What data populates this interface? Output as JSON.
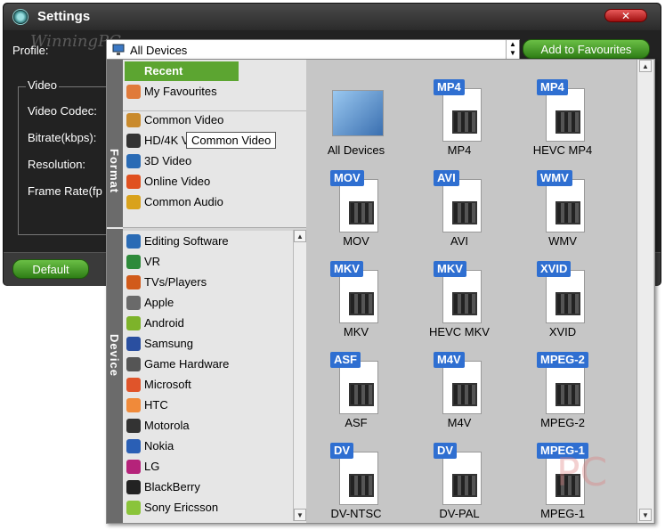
{
  "window": {
    "title": "Settings",
    "close_label": "✕",
    "watermark": "WinningPC"
  },
  "profile": {
    "label": "Profile:",
    "value": "All Devices",
    "add_favourites_label": "Add to Favourites"
  },
  "video_settings": {
    "group_label": "Video",
    "labels": [
      "Video Codec:",
      "Bitrate(kbps):",
      "Resolution:",
      "Frame Rate(fp"
    ]
  },
  "default_button_label": "Default",
  "left_panel": {
    "format_tab_label": "Format",
    "device_tab_label": "Device",
    "format_items": [
      {
        "label": "Recent",
        "icon": "grid-icon",
        "selected": true
      },
      {
        "label": "My Favourites",
        "icon": "heart-icon"
      },
      {
        "label": "Common Video",
        "icon": "film-icon"
      },
      {
        "label": "HD/4K V",
        "icon": "hd-icon"
      },
      {
        "label": "3D Video",
        "icon": "3d-icon"
      },
      {
        "label": "Online Video",
        "icon": "flash-icon"
      },
      {
        "label": "Common Audio",
        "icon": "music-note-icon"
      }
    ],
    "device_items": [
      {
        "label": "Editing Software",
        "icon": "clapper-icon"
      },
      {
        "label": "VR",
        "icon": "vr-icon"
      },
      {
        "label": "TVs/Players",
        "icon": "tv-icon"
      },
      {
        "label": "Apple",
        "icon": "apple-icon"
      },
      {
        "label": "Android",
        "icon": "android-icon"
      },
      {
        "label": "Samsung",
        "icon": "samsung-phone-icon"
      },
      {
        "label": "Game Hardware",
        "icon": "gamepad-icon"
      },
      {
        "label": "Microsoft",
        "icon": "windows-icon"
      },
      {
        "label": "HTC",
        "icon": "htc-icon"
      },
      {
        "label": "Motorola",
        "icon": "motorola-icon"
      },
      {
        "label": "Nokia",
        "icon": "nokia-icon"
      },
      {
        "label": "LG",
        "icon": "lg-icon"
      },
      {
        "label": "BlackBerry",
        "icon": "blackberry-icon"
      },
      {
        "label": "Sony Ericsson",
        "icon": "sony-ericsson-icon"
      }
    ],
    "tooltip": "Common Video"
  },
  "formats": [
    {
      "label": "All Devices",
      "badge": ""
    },
    {
      "label": "MP4",
      "badge": "MP4"
    },
    {
      "label": "HEVC MP4",
      "badge": "MP4"
    },
    {
      "label": "MOV",
      "badge": "MOV"
    },
    {
      "label": "AVI",
      "badge": "AVI"
    },
    {
      "label": "WMV",
      "badge": "WMV"
    },
    {
      "label": "MKV",
      "badge": "MKV"
    },
    {
      "label": "HEVC MKV",
      "badge": "MKV"
    },
    {
      "label": "XVID",
      "badge": "XVID"
    },
    {
      "label": "ASF",
      "badge": "ASF"
    },
    {
      "label": "M4V",
      "badge": "M4V"
    },
    {
      "label": "MPEG-2",
      "badge": "MPEG-2"
    },
    {
      "label": "DV-NTSC",
      "badge": "DV"
    },
    {
      "label": "DV-PAL",
      "badge": "DV"
    },
    {
      "label": "MPEG-1",
      "badge": "MPEG-1"
    }
  ],
  "colors": {
    "accent_green": "#5ca531",
    "badge_blue": "#2f6fd1"
  }
}
